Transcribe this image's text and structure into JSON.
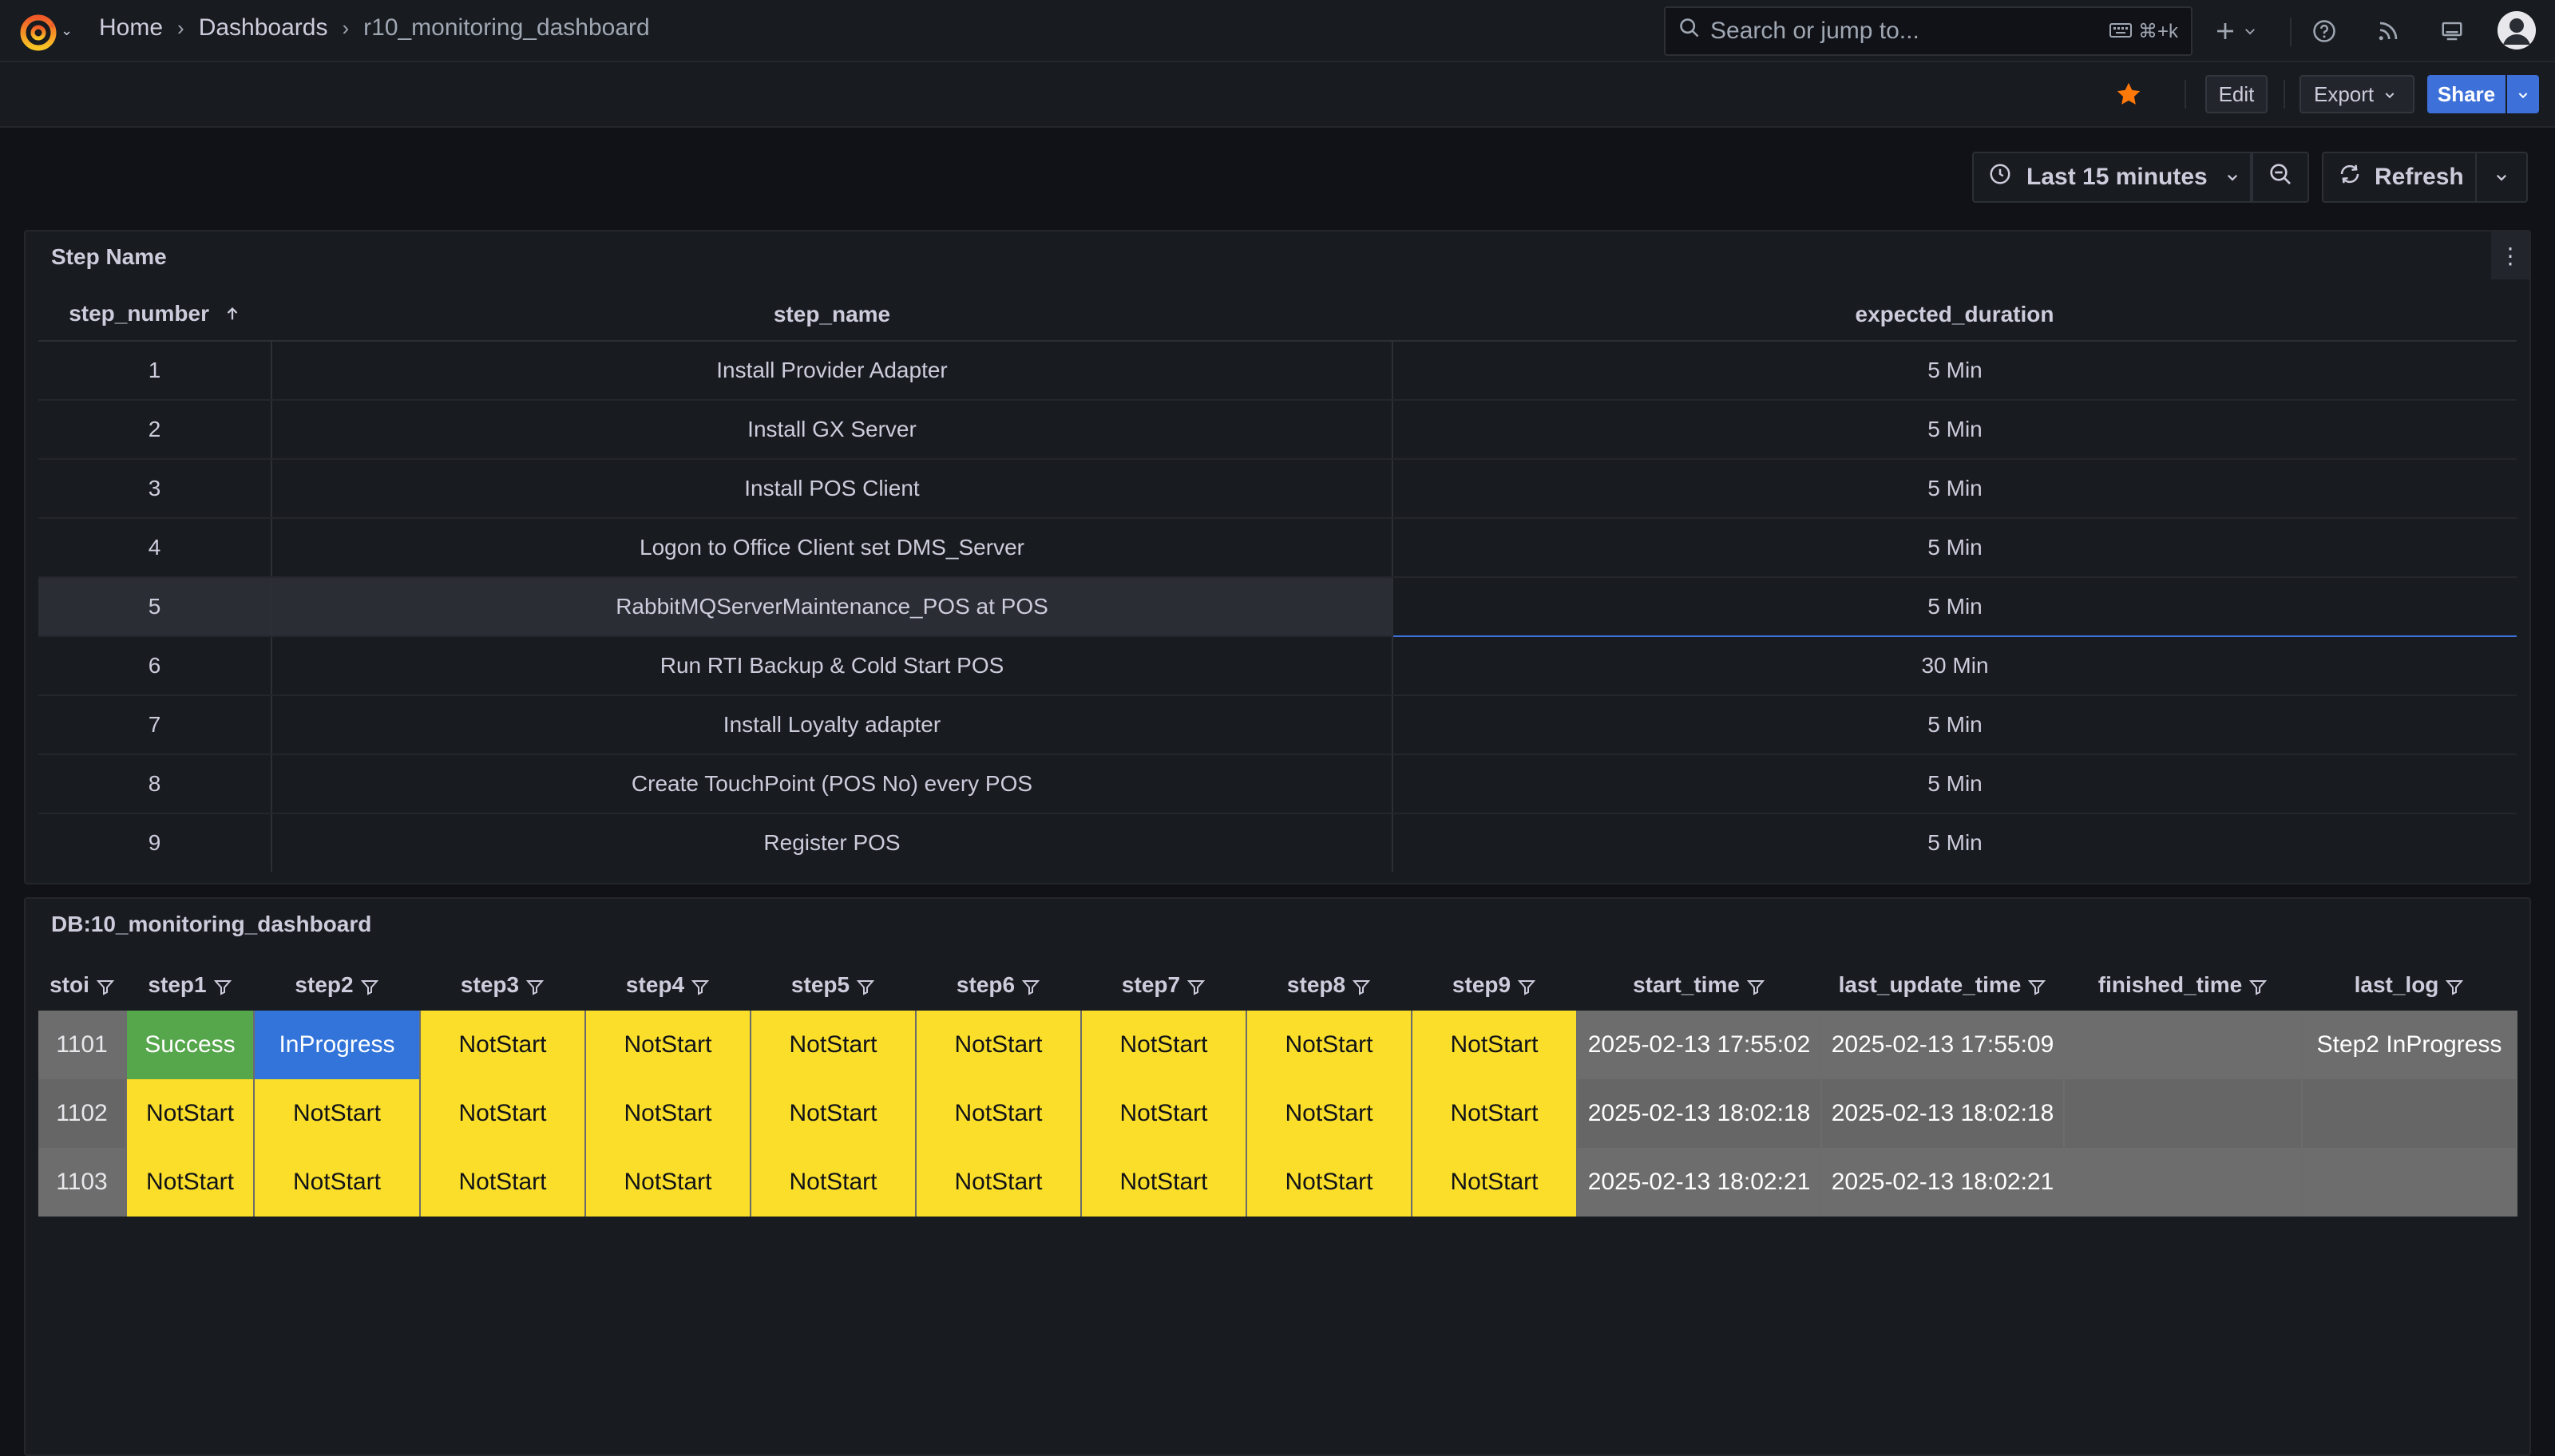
{
  "nav": {
    "breadcrumbs": [
      "Home",
      "Dashboards",
      "r10_monitoring_dashboard"
    ],
    "search_placeholder": "Search or jump to...",
    "search_shortcut": "⌘+k"
  },
  "toolbar": {
    "edit": "Edit",
    "export": "Export",
    "share": "Share"
  },
  "timepicker": {
    "range": "Last 15 minutes",
    "refresh": "Refresh"
  },
  "panel1": {
    "title": "Step Name",
    "columns": [
      "step_number",
      "step_name",
      "expected_duration"
    ],
    "rows": [
      [
        "1",
        "Install Provider Adapter",
        "5 Min"
      ],
      [
        "2",
        "Install GX Server",
        "5 Min"
      ],
      [
        "3",
        "Install POS Client",
        "5 Min"
      ],
      [
        "4",
        "Logon to Office Client set DMS_Server",
        "5 Min"
      ],
      [
        "5",
        "RabbitMQServerMaintenance_POS at POS",
        "5 Min"
      ],
      [
        "6",
        "Run RTI Backup & Cold Start POS",
        "30 Min"
      ],
      [
        "7",
        "Install Loyalty adapter",
        "5 Min"
      ],
      [
        "8",
        "Create TouchPoint (POS No) every POS",
        "5 Min"
      ],
      [
        "9",
        "Register POS",
        "5 Min"
      ]
    ]
  },
  "panel2": {
    "title": "DB:10_monitoring_dashboard",
    "columns": [
      "stoi",
      "step1",
      "step2",
      "step3",
      "step4",
      "step5",
      "step6",
      "step7",
      "step8",
      "step9",
      "start_time",
      "last_update_time",
      "finished_time",
      "last_log"
    ],
    "rows": [
      [
        "1101",
        "Success",
        "InProgress",
        "NotStart",
        "NotStart",
        "NotStart",
        "NotStart",
        "NotStart",
        "NotStart",
        "NotStart",
        "2025-02-13 17:55:02",
        "2025-02-13 17:55:09",
        "",
        "Step2 InProgress"
      ],
      [
        "1102",
        "NotStart",
        "NotStart",
        "NotStart",
        "NotStart",
        "NotStart",
        "NotStart",
        "NotStart",
        "NotStart",
        "NotStart",
        "2025-02-13 18:02:18",
        "2025-02-13 18:02:18",
        "",
        ""
      ],
      [
        "1103",
        "NotStart",
        "NotStart",
        "NotStart",
        "NotStart",
        "NotStart",
        "NotStart",
        "NotStart",
        "NotStart",
        "NotStart",
        "2025-02-13 18:02:21",
        "2025-02-13 18:02:21",
        "",
        ""
      ]
    ]
  },
  "colors": {
    "success": "#56a64b",
    "in_progress": "#3274d9",
    "not_start": "#fade2a",
    "neutral": "#6d6d6d",
    "favorite_star": "#ff780a"
  }
}
